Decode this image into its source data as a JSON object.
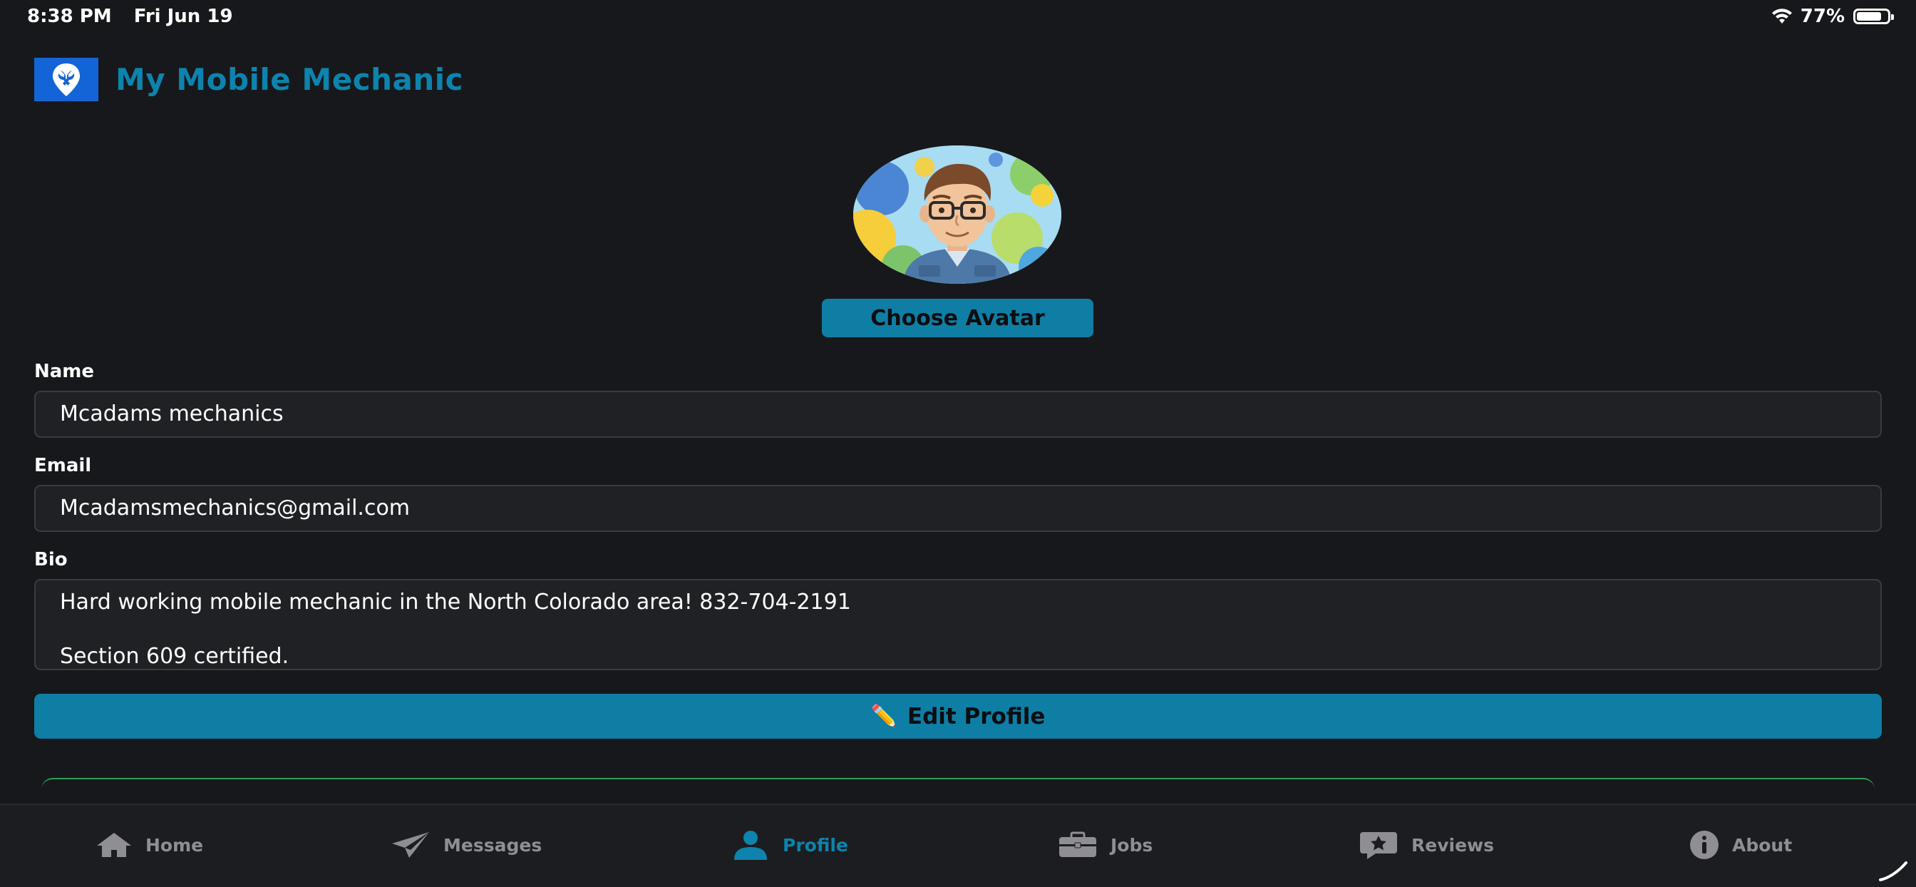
{
  "status_bar": {
    "time": "8:38 PM",
    "date": "Fri Jun 19",
    "battery": "77%",
    "battery_level": 0.77
  },
  "header": {
    "app_title": "My Mobile Mechanic",
    "logo_icon": "wrench-location-pin-icon"
  },
  "avatar": {
    "icon": "cartoon-avatar-man-glasses",
    "choose_label": "Choose Avatar"
  },
  "form": {
    "name_label": "Name",
    "name_value": "Mcadams mechanics",
    "email_label": "Email",
    "email_value": "Mcadamsmechanics@gmail.com",
    "bio_label": "Bio",
    "bio_value": "Hard working mobile mechanic in the North Colorado area! 832-704-2191\n\nSection 609 certified."
  },
  "actions": {
    "edit_profile_icon": "✏️",
    "edit_profile_label": "Edit Profile"
  },
  "tabs": [
    {
      "label": "Home",
      "icon": "home-icon",
      "active": false
    },
    {
      "label": "Messages",
      "icon": "paper-plane-icon",
      "active": false
    },
    {
      "label": "Profile",
      "icon": "user-icon",
      "active": true
    },
    {
      "label": "Jobs",
      "icon": "briefcase-icon",
      "active": false
    },
    {
      "label": "Reviews",
      "icon": "star-message-icon",
      "active": false
    },
    {
      "label": "About",
      "icon": "info-icon",
      "active": false
    }
  ],
  "colors": {
    "background": "#17181b",
    "accent": "#0d83ad",
    "button": "#0f7ea4",
    "inactive_tab": "#8e8e93",
    "logo_bg": "#1364d6",
    "card_border": "#2f9e57"
  }
}
